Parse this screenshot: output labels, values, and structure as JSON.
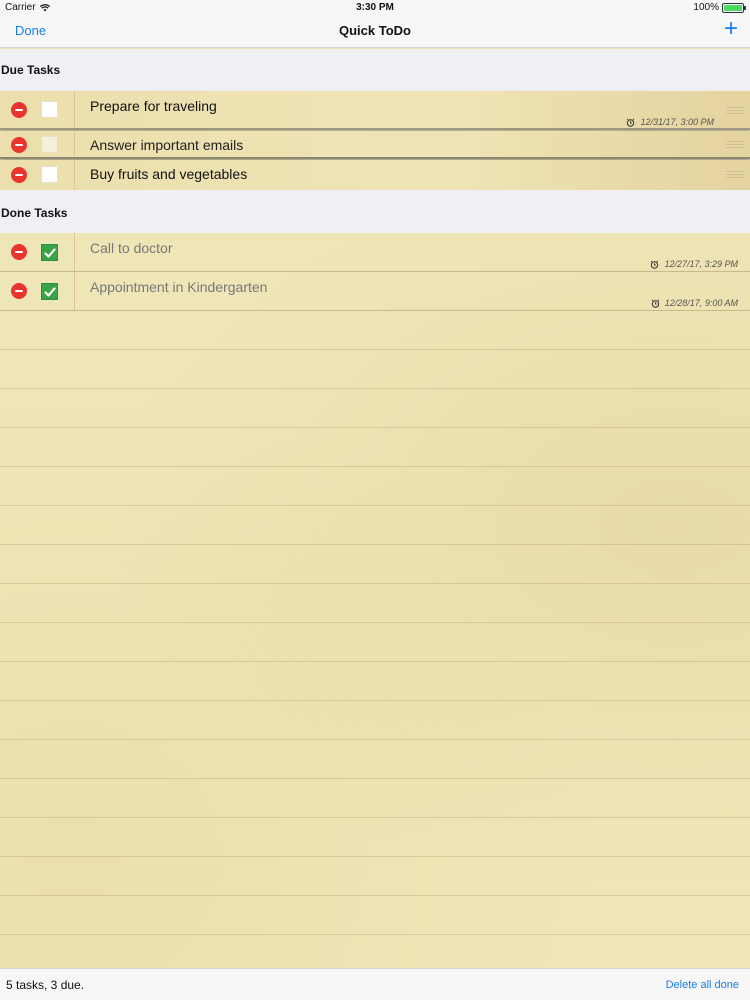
{
  "status_bar": {
    "carrier": "Carrier",
    "time": "3:30 PM",
    "battery": "100%",
    "battery_level": 1.0
  },
  "nav": {
    "done_label": "Done",
    "title": "Quick ToDo",
    "add_label": "+"
  },
  "sections": {
    "due_title": "Due Tasks",
    "done_title": "Done Tasks"
  },
  "due_tasks": [
    {
      "text": "Prepare for traveling",
      "due": "12/31/17, 3:00 PM"
    },
    {
      "text": "Answer important emails",
      "due": ""
    },
    {
      "text": "Buy fruits and vegetables",
      "due": ""
    }
  ],
  "done_tasks": [
    {
      "text": "Call to doctor",
      "due": "12/27/17, 3:29 PM"
    },
    {
      "text": "Appointment in Kindergarten",
      "due": "12/28/17, 9:00 AM"
    }
  ],
  "toolbar": {
    "summary": "5 tasks, 3 due.",
    "delete_all_label": "Delete all done"
  },
  "colors": {
    "accent": "#1a7ee8",
    "delete": "#e8362e",
    "check": "#3aa348",
    "paper": "#efe6b8"
  }
}
